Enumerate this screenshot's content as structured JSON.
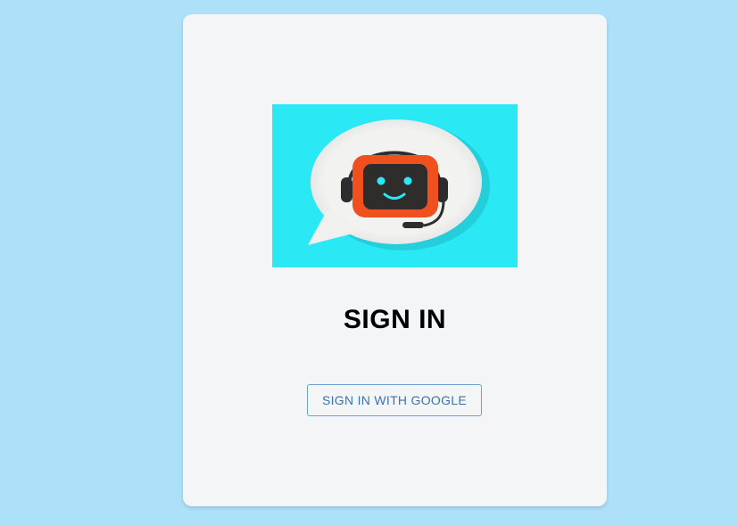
{
  "signin": {
    "title": "SIGN IN",
    "google_button_label": "SIGN IN WITH GOOGLE",
    "logo_icon": "chatbot-headset-icon"
  },
  "colors": {
    "page_background": "#ade1fa",
    "card_background": "#f3f5f7",
    "logo_background": "#2ae8f4",
    "robot_frame": "#f0501e",
    "button_border": "#6ea1d3",
    "button_text": "#3b74ad"
  }
}
